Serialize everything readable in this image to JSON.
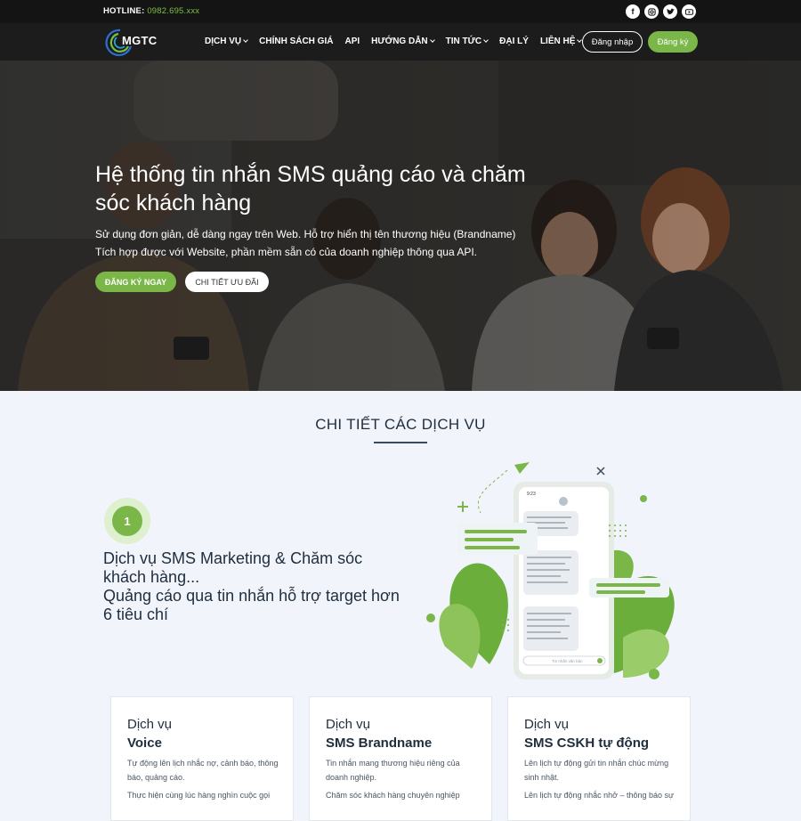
{
  "topbar": {
    "hotline_label": "HOTLINE:",
    "hotline_number": "0982.695.xxx",
    "socials": [
      "facebook-icon",
      "instagram-icon",
      "twitter-icon",
      "youtube-icon"
    ]
  },
  "nav": {
    "logo_text": "MGTC",
    "items": [
      {
        "label": "DỊCH VỤ",
        "dropdown": true
      },
      {
        "label": "CHÍNH SÁCH GIÁ",
        "dropdown": false
      },
      {
        "label": "API",
        "dropdown": false
      },
      {
        "label": "HƯỚNG DẪN",
        "dropdown": true
      },
      {
        "label": "TIN TỨC",
        "dropdown": true
      },
      {
        "label": "ĐẠI LÝ",
        "dropdown": false
      },
      {
        "label": "LIÊN HỆ",
        "dropdown": true
      }
    ],
    "login_label": "Đăng nhập",
    "register_label": "Đăng ký"
  },
  "hero": {
    "title": "Hệ thống tin nhắn SMS quảng cáo và chăm sóc khách hàng",
    "desc_line1": "Sử dụng đơn giản, dễ dàng ngay trên Web. Hỗ trợ hiển thị tên thương hiệu (Brandname)",
    "desc_line2": "Tích hợp được với Website, phần mềm sẵn có của doanh nghiệp thông qua API.",
    "cta_primary": "ĐĂNG KÝ NGAY",
    "cta_secondary": "CHI TIẾT ƯU ĐÃI"
  },
  "services": {
    "section_title": "CHI TIẾT CÁC DỊCH VỤ",
    "step_number": "1",
    "step_title_line1": "Dịch vụ SMS Marketing & Chăm sóc khách hàng...",
    "step_title_line2": "Quảng cáo qua tin nhắn hỗ trợ target hơn 6 tiêu chí",
    "cards": [
      {
        "title_line1": "Dịch vụ",
        "title_line2": "Voice",
        "desc": [
          "Tự động lên lịch nhắc nợ, cảnh báo, thông báo, quảng cáo.",
          "Thực hiện cùng lúc hàng nghìn cuộc gọi"
        ]
      },
      {
        "title_line1": "Dịch vụ",
        "title_line2": "SMS Brandname",
        "desc": [
          "Tin nhắn mang thương hiệu riêng của doanh nghiệp.",
          "Chăm sóc khách hàng chuyên nghiệp"
        ]
      },
      {
        "title_line1": "Dịch vụ",
        "title_line2": "SMS CSKH tự động",
        "desc": [
          "Lên lịch tự động gửi tin nhắn chúc mừng sinh nhật.",
          "Lên lịch tự động nhắc nhở – thông báo sự"
        ]
      }
    ]
  },
  "phone": {
    "time": "9:23",
    "input_placeholder": "Tin nhắn văn bản"
  },
  "colors": {
    "accent": "#7ab648",
    "dark": "#1c1c1c",
    "section_bg": "#f1f5fb"
  }
}
